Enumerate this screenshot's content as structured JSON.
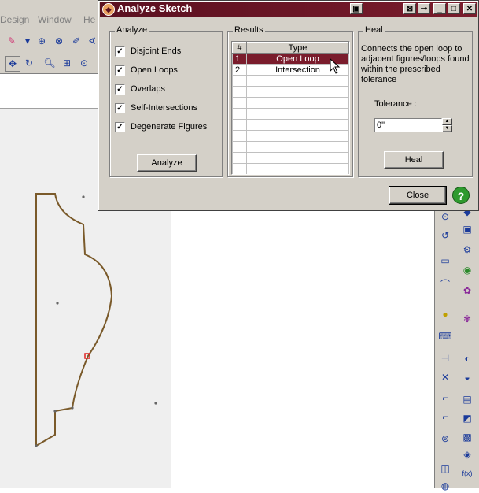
{
  "app": {
    "menu": [
      "Design",
      "Window",
      "He"
    ]
  },
  "dialog": {
    "title": "Analyze Sketch",
    "analyze_group": {
      "legend": "Analyze",
      "options": [
        {
          "label": "Disjoint Ends",
          "checked": true
        },
        {
          "label": "Open Loops",
          "checked": true
        },
        {
          "label": "Overlaps",
          "checked": true
        },
        {
          "label": "Self-Intersections",
          "checked": true
        },
        {
          "label": "Degenerate Figures",
          "checked": true
        }
      ],
      "analyze_button": "Analyze"
    },
    "results_group": {
      "legend": "Results",
      "columns": [
        "#",
        "Type"
      ],
      "rows": [
        {
          "num": "1",
          "type": "Open Loop",
          "selected": true
        },
        {
          "num": "2",
          "type": "Intersection",
          "selected": false
        }
      ]
    },
    "heal_group": {
      "legend": "Heal",
      "description": "Connects the open loop to adjacent figures/loops found within the prescribed tolerance",
      "tolerance_label": "Tolerance :",
      "tolerance_value": "0\"",
      "heal_button": "Heal"
    },
    "close_button": "Close",
    "help_icon": "?"
  },
  "colors": {
    "title_bar": "#6a1626",
    "selection": "#7a1c2c",
    "sketch_stroke": "#7a5a2a"
  }
}
